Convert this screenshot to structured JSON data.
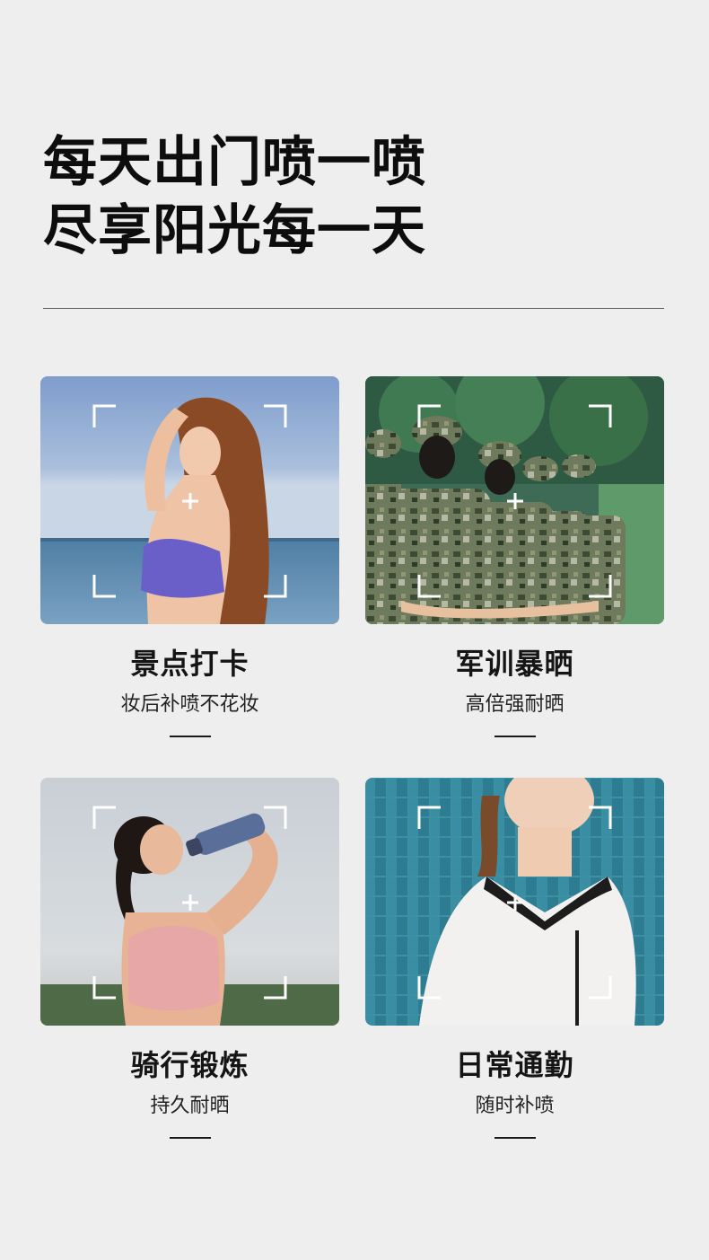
{
  "headline": {
    "line1": "每天出门喷一喷",
    "line2": "尽享阳光每一天"
  },
  "cards": [
    {
      "title": "景点打卡",
      "subtitle": "妆后补喷不花妆",
      "photo_icon": "beach-portrait-photo"
    },
    {
      "title": "军训暴晒",
      "subtitle": "高倍强耐晒",
      "photo_icon": "military-training-photo"
    },
    {
      "title": "骑行锻炼",
      "subtitle": "持久耐晒",
      "photo_icon": "fitness-drinking-photo"
    },
    {
      "title": "日常通勤",
      "subtitle": "随时补喷",
      "photo_icon": "commute-portrait-photo"
    }
  ],
  "colors": {
    "background": "#eeeeee",
    "text": "#111111",
    "divider": "#6b6b6b",
    "viewfinder": "#ffffff"
  }
}
